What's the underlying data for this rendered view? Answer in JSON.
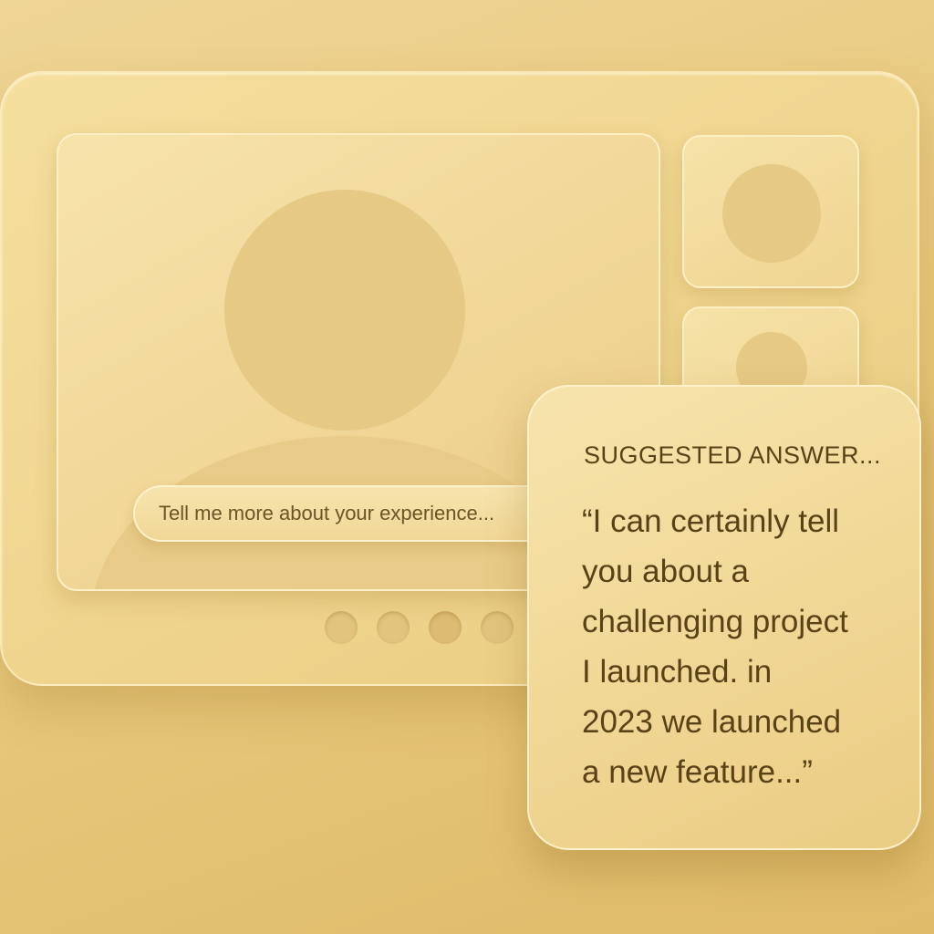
{
  "call": {
    "caption": "Tell me more about your experience..."
  },
  "suggestion": {
    "heading": "SUGGESTED ANSWER...",
    "lines": [
      "“I can certainly tell",
      "you about a",
      "challenging project",
      "I launched. in",
      "2023 we launched",
      "a new feature...”"
    ]
  },
  "icons": {
    "main_avatar": "person-avatar-icon",
    "thumb_avatar": "person-avatar-icon"
  },
  "colors": {
    "background": "#e8c97e",
    "panel": "#f5df9f",
    "text": "#5a4218"
  }
}
